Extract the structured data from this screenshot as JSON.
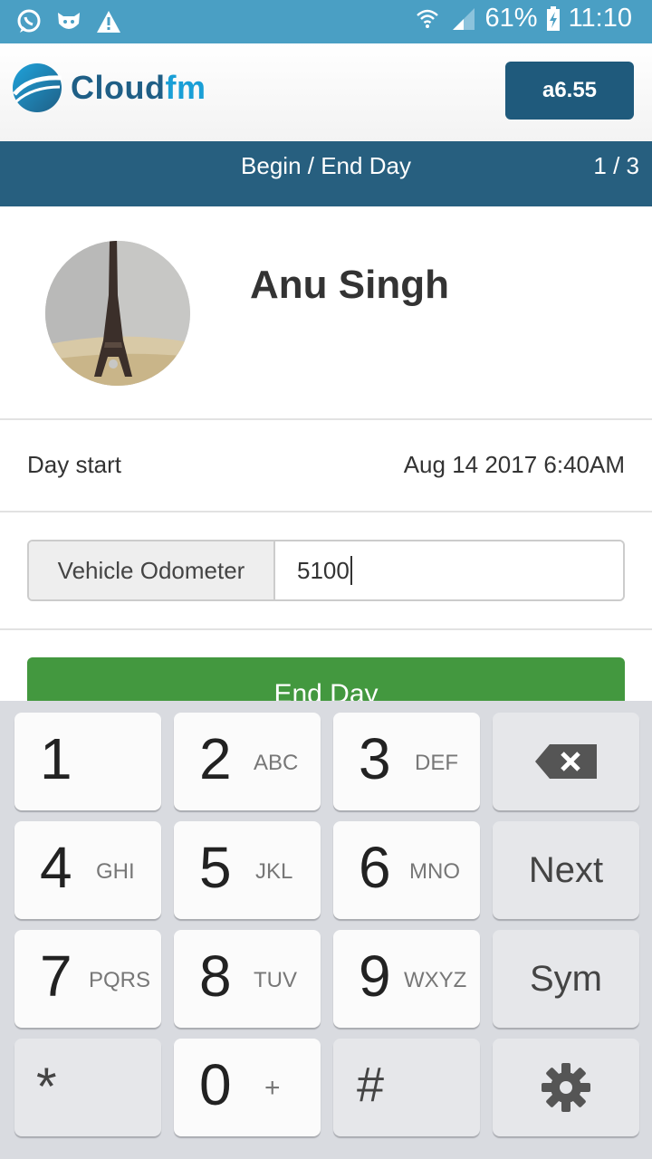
{
  "status_bar": {
    "battery": "61%",
    "time": "11:10",
    "icons": [
      "whatsapp-icon",
      "tiger-app-icon",
      "warning-icon",
      "wifi-icon",
      "signal-icon",
      "battery-charging-icon"
    ]
  },
  "header": {
    "logo_text_main": "Cloud",
    "logo_text_accent": "fm",
    "version_label": "a6.55",
    "brand_color": "#1f5a7c"
  },
  "titlebar": {
    "title": "Begin / End Day",
    "pager": "1 / 3"
  },
  "profile": {
    "name": "Anu Singh"
  },
  "day_start": {
    "label": "Day start",
    "value": "Aug 14 2017 6:40AM"
  },
  "odometer": {
    "label": "Vehicle Odometer",
    "value": "5100"
  },
  "actions": {
    "end_day_label": "End Day",
    "end_day_color": "#43983f"
  },
  "keyboard": {
    "keys": {
      "k1": {
        "digit": "1",
        "letters": ""
      },
      "k2": {
        "digit": "2",
        "letters": "ABC"
      },
      "k3": {
        "digit": "3",
        "letters": "DEF"
      },
      "k4": {
        "digit": "4",
        "letters": "GHI"
      },
      "k5": {
        "digit": "5",
        "letters": "JKL"
      },
      "k6": {
        "digit": "6",
        "letters": "MNO"
      },
      "k7": {
        "digit": "7",
        "letters": "PQRS"
      },
      "k8": {
        "digit": "8",
        "letters": "TUV"
      },
      "k9": {
        "digit": "9",
        "letters": "WXYZ"
      },
      "kstar": {
        "digit": "*"
      },
      "k0": {
        "digit": "0",
        "letters": "+"
      },
      "khash": {
        "digit": "#"
      }
    },
    "next_label": "Next",
    "sym_label": "Sym"
  }
}
